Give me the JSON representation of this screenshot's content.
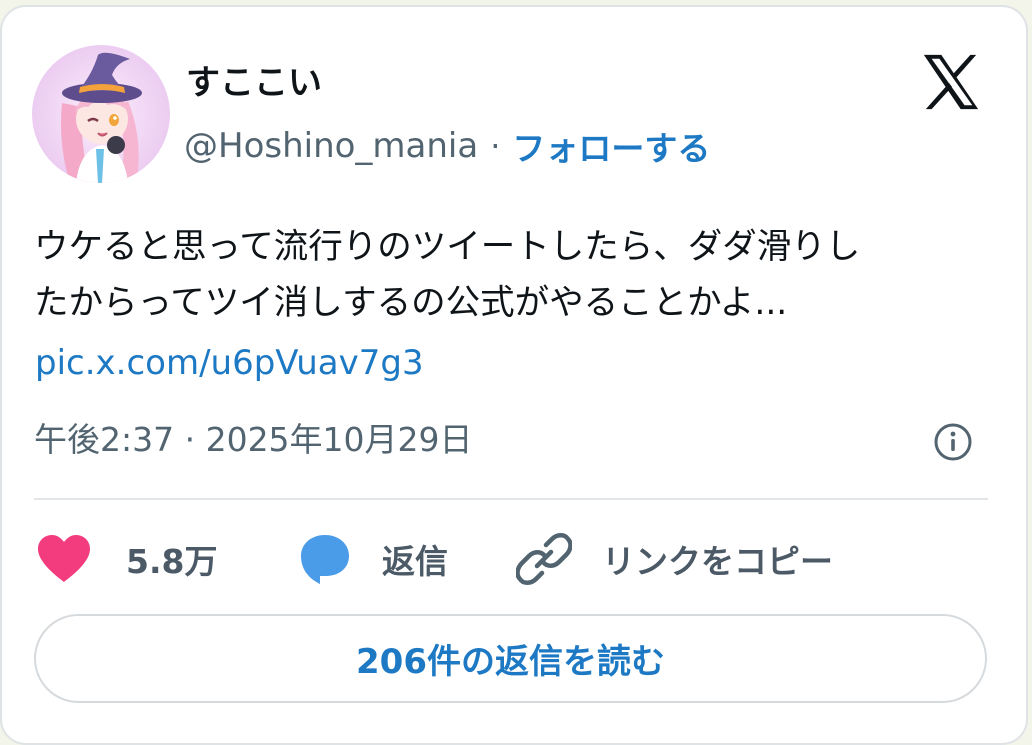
{
  "user": {
    "display_name": "すここい",
    "handle": "@Hoshino_mania",
    "separator": "·",
    "follow_label": "フォローする",
    "avatar_icon": "witch-avatar-icon"
  },
  "brand": {
    "logo_icon": "x-logo-icon"
  },
  "tweet": {
    "text_line_1": "ウケると思って流行りのツイートしたら、ダダ滑りし",
    "text_line_2": "たからってツイ消しするの公式がやることかよ...",
    "link": "pic.x.com/u6pVuav7g3",
    "timestamp": "午後2:37 · 2025年10月29日",
    "info_icon": "info-icon"
  },
  "actions": {
    "like_count": "5.8万",
    "reply_label": "返信",
    "copy_link_label": "リンクをコピー",
    "like_icon": "heart-icon",
    "reply_icon": "speech-bubble-icon",
    "copy_icon": "link-icon"
  },
  "read_replies_label": "206件の返信を読む",
  "colors": {
    "link_blue": "#1d79c4",
    "heart_pink": "#f23c7e",
    "reply_blue": "#4a9be8",
    "secondary_text": "#536471"
  }
}
